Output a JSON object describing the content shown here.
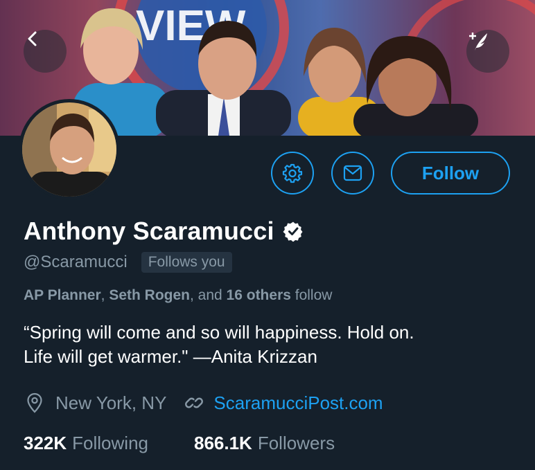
{
  "banner": {
    "back_icon": "chevron-left-icon",
    "compose_icon": "compose-quill-icon",
    "banner_caption": "VIEW"
  },
  "profile": {
    "name": "Anthony Scaramucci",
    "verified_icon": "verified-badge-icon",
    "handle": "@Scaramucci",
    "follows_you": "Follows you",
    "known_followers": {
      "first": "AP Planner",
      "sep1": ", ",
      "second": "Seth Rogen",
      "sep2": ", and ",
      "others": "16 others",
      "suffix": " follow"
    },
    "bio_line1": "“Spring will come and so will happiness. Hold on.",
    "bio_line2": "Life will get warmer.\" —Anita Krizzan",
    "location": "New York, NY",
    "website": "ScaramucciPost.com"
  },
  "actions": {
    "settings_icon": "gear-icon",
    "message_icon": "envelope-icon",
    "follow_label": "Follow"
  },
  "stats": {
    "following_count": "322K",
    "following_label": "Following",
    "followers_count": "866.1K",
    "followers_label": "Followers"
  },
  "colors": {
    "background": "#15202b",
    "accent": "#1da1f2",
    "muted": "#8899a6",
    "text": "#ffffff"
  }
}
